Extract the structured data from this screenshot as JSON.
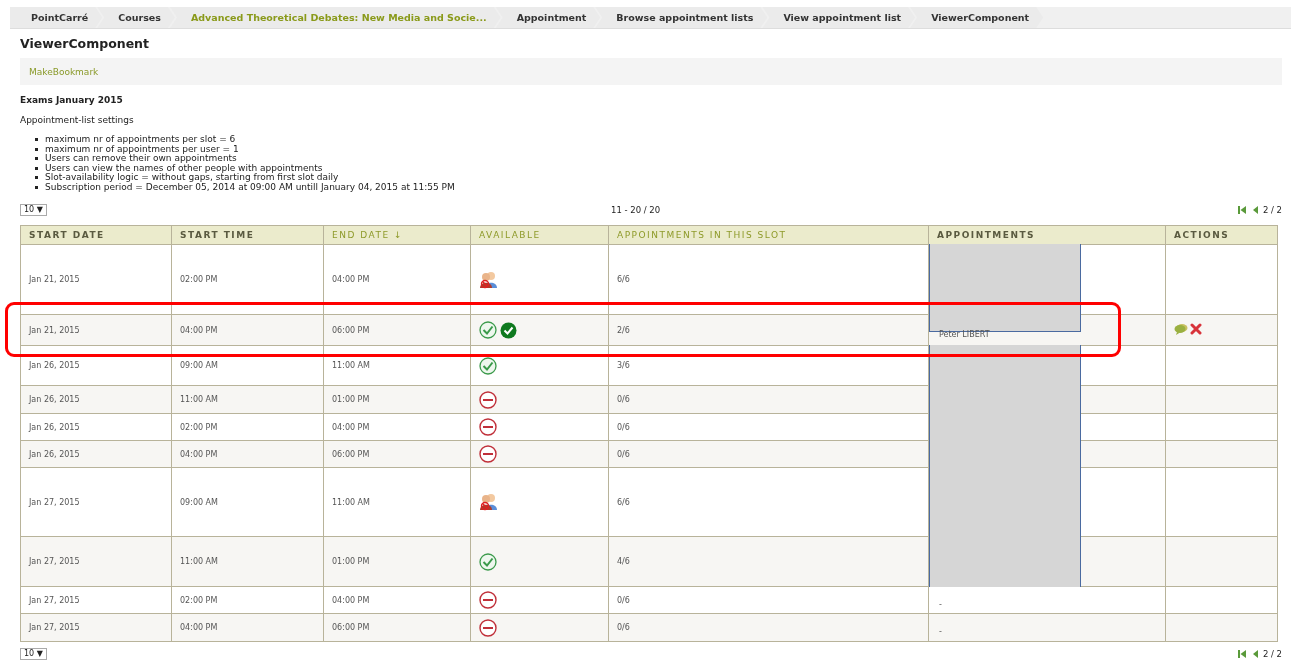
{
  "breadcrumbs": [
    {
      "label": "PointCarré",
      "highlighted": false
    },
    {
      "label": "Courses",
      "highlighted": false
    },
    {
      "label": "Advanced Theoretical Debates: New Media and Socie...",
      "highlighted": true
    },
    {
      "label": "Appointment",
      "highlighted": false
    },
    {
      "label": "Browse appointment lists",
      "highlighted": false
    },
    {
      "label": "View appointment list",
      "highlighted": false
    },
    {
      "label": "ViewerComponent",
      "highlighted": false
    }
  ],
  "page_title": "ViewerComponent",
  "toolbar": {
    "link": "MakeBookmark"
  },
  "list_title": "Exams January 2015",
  "settings_title": "Appointment-list settings",
  "settings": [
    "maximum nr of appointments per slot = 6",
    "maximum nr of appointments per user = 1",
    "Users can remove their own appointments",
    "Users can view the names of other people with appointments",
    "Slot-availability logic = without gaps, starting from first slot daily",
    "Subscription period = December 05, 2014 at 09:00 AM untill January 04, 2015 at 11:55 PM"
  ],
  "pager_top": {
    "page_size": "10 ▼",
    "range": "11 - 20 / 20",
    "page": "2 / 2"
  },
  "table": {
    "columns": [
      {
        "label": "START DATE",
        "sortable": false
      },
      {
        "label": "START TIME",
        "sortable": false
      },
      {
        "label": "END DATE ↓",
        "sortable": true
      },
      {
        "label": "AVAILABLE",
        "sortable": true
      },
      {
        "label": "APPOINTMENTS IN THIS SLOT",
        "sortable": true
      },
      {
        "label": "APPOINTMENTS",
        "sortable": false
      },
      {
        "label": "ACTIONS",
        "sortable": false
      }
    ],
    "rows": [
      {
        "start_date": "Jan 21, 2015",
        "start_time": "02:00 PM",
        "end_date": "04:00 PM",
        "kind": "full",
        "count": "6/6",
        "appointments": [],
        "redacted": true,
        "removable": false
      },
      {
        "start_date": "Jan 21, 2015",
        "start_time": "04:00 PM",
        "end_date": "06:00 PM",
        "kind": "subscribed",
        "count": "2/6",
        "appointments": [
          "Peter LIBERT"
        ],
        "redacted": true,
        "removable": true
      },
      {
        "start_date": "Jan 26, 2015",
        "start_time": "09:00 AM",
        "end_date": "11:00 AM",
        "kind": "open",
        "count": "3/6",
        "appointments": [],
        "redacted": true,
        "removable": false
      },
      {
        "start_date": "Jan 26, 2015",
        "start_time": "11:00 AM",
        "end_date": "01:00 PM",
        "kind": "closed",
        "count": "0/6",
        "appointments": [],
        "redacted": true,
        "removable": false
      },
      {
        "start_date": "Jan 26, 2015",
        "start_time": "02:00 PM",
        "end_date": "04:00 PM",
        "kind": "closed",
        "count": "0/6",
        "appointments": [],
        "redacted": true,
        "removable": false
      },
      {
        "start_date": "Jan 26, 2015",
        "start_time": "04:00 PM",
        "end_date": "06:00 PM",
        "kind": "closed",
        "count": "0/6",
        "appointments": [],
        "redacted": true,
        "removable": false
      },
      {
        "start_date": "Jan 27, 2015",
        "start_time": "09:00 AM",
        "end_date": "11:00 AM",
        "kind": "full",
        "count": "6/6",
        "appointments": [],
        "redacted": true,
        "removable": false
      },
      {
        "start_date": "Jan 27, 2015",
        "start_time": "11:00 AM",
        "end_date": "01:00 PM",
        "kind": "open",
        "count": "4/6",
        "appointments": [],
        "redacted": true,
        "removable": false
      },
      {
        "start_date": "Jan 27, 2015",
        "start_time": "02:00 PM",
        "end_date": "04:00 PM",
        "kind": "closed",
        "count": "0/6",
        "appointments": [
          "-"
        ],
        "redacted": false,
        "removable": false
      },
      {
        "start_date": "Jan 27, 2015",
        "start_time": "04:00 PM",
        "end_date": "06:00 PM",
        "kind": "closed",
        "count": "0/6",
        "appointments": [
          "-"
        ],
        "redacted": false,
        "removable": false
      }
    ]
  },
  "pager_bottom": {
    "page_size": "10 ▼",
    "page": "2 / 2"
  }
}
